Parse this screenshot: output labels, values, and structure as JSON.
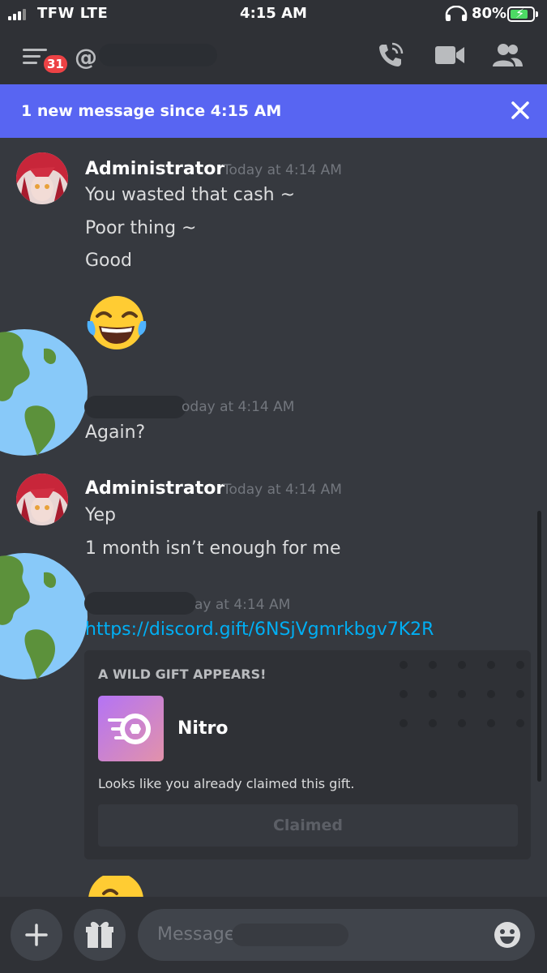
{
  "status_bar": {
    "carrier": "TFW  LTE",
    "time": "4:15 AM",
    "battery": "80%",
    "battery_level": 0.8
  },
  "nav": {
    "unread_count": "31",
    "channel_prefix": "@"
  },
  "banner": {
    "text": "1 new message since 4:15 AM"
  },
  "messages": [
    {
      "author": "Administrator",
      "timestamp": "Today at 4:14 AM",
      "lines": [
        "You wasted that cash ~",
        "Poor thing ~",
        "Good"
      ],
      "emoji": "😂"
    },
    {
      "timestamp_partial": "oday at 4:14 AM",
      "lines": [
        "Again?"
      ]
    },
    {
      "author": "Administrator",
      "timestamp": "Today at 4:14 AM",
      "lines": [
        "Yep",
        "1 month isn’t enough for me"
      ]
    },
    {
      "timestamp_partial": "ay at 4:14 AM",
      "link": "https://discord.gift/6NSjVgmrkbgv7K2R",
      "gift": {
        "header": "A WILD GIFT APPEARS!",
        "name": "Nitro",
        "note": "Looks like you already claimed this gift.",
        "button": "Claimed"
      }
    }
  ],
  "input": {
    "placeholder": "Message"
  },
  "colors": {
    "accent": "#5865f2",
    "link": "#00aff4",
    "badge": "#ed4245"
  }
}
